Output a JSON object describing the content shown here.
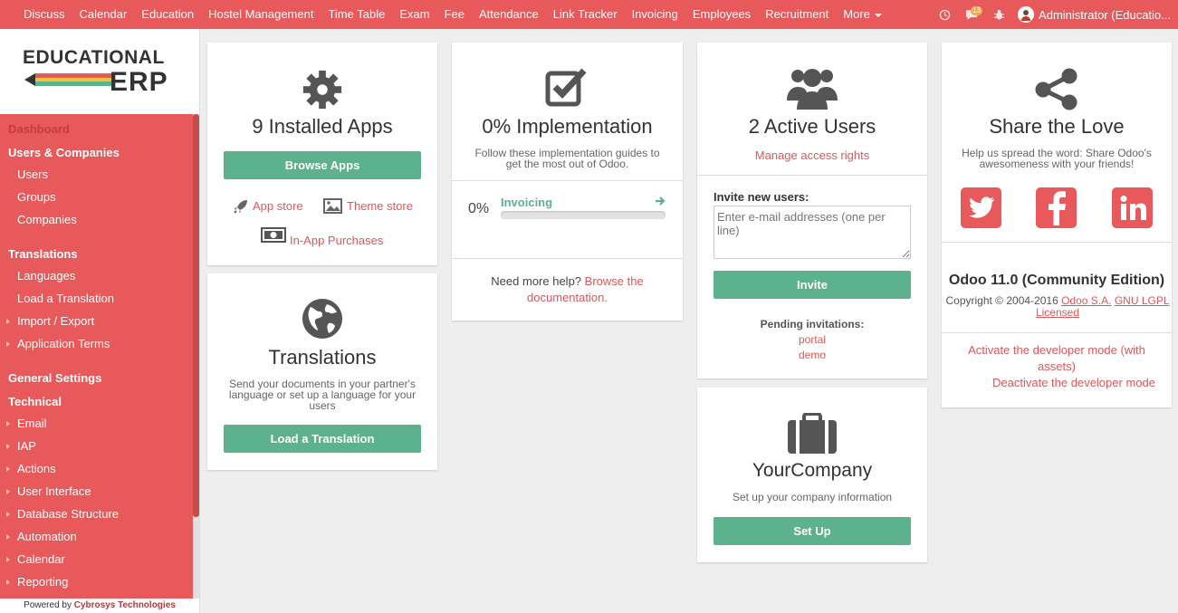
{
  "topbar": {
    "menus": [
      "Discuss",
      "Calendar",
      "Education",
      "Hostel Management",
      "Time Table",
      "Exam",
      "Fee",
      "Attendance",
      "Link Tracker",
      "Invoicing",
      "Employees",
      "Recruitment"
    ],
    "more_label": "More",
    "chat_count": "13",
    "user_name": "Administrator (Educatio..."
  },
  "sidebar": {
    "logo_line1": "EDUCATIONAL",
    "logo_line2": "ERP",
    "active": "Dashboard",
    "users_companies": "Users & Companies",
    "users": "Users",
    "groups": "Groups",
    "companies": "Companies",
    "translations": "Translations",
    "languages": "Languages",
    "load_translation": "Load a Translation",
    "import_export": "Import / Export",
    "application_terms": "Application Terms",
    "general_settings": "General Settings",
    "technical": "Technical",
    "email": "Email",
    "iap": "IAP",
    "actions": "Actions",
    "user_interface": "User Interface",
    "database_structure": "Database Structure",
    "automation": "Automation",
    "calendar": "Calendar",
    "reporting": "Reporting",
    "powered_by": "Powered by",
    "powered_company": "Cybrosys Technologies"
  },
  "apps_card": {
    "title": "9 Installed Apps",
    "button": "Browse Apps",
    "app_store": "App store",
    "theme_store": "Theme store",
    "in_app": "In-App Purchases"
  },
  "translations_card": {
    "title": "Translations",
    "description": "Send your documents in your partner's language or set up a language for your users",
    "button": "Load a Translation"
  },
  "implementation_card": {
    "title": "0% Implementation",
    "description": "Follow these implementation guides to get the most out of Odoo.",
    "percent": "0%",
    "guide": "Invoicing",
    "progress": 0,
    "help_text": "Need more help?",
    "help_link": "Browse the documentation."
  },
  "users_card": {
    "title": "2 Active Users",
    "manage": "Manage access rights",
    "invite_label": "Invite new users:",
    "invite_placeholder": "Enter e-mail addresses (one per line)",
    "invite_button": "Invite",
    "pending_label": "Pending invitations:",
    "pending": [
      "portal",
      "demo"
    ]
  },
  "company_card": {
    "title": "YourCompany",
    "description": "Set up your company information",
    "button": "Set Up"
  },
  "share_card": {
    "title": "Share the Love",
    "description": "Help us spread the word: Share Odoo's awesomeness with your friends!",
    "version": "Odoo 11.0 (Community Edition)",
    "copyright": "Copyright © 2004-2016",
    "odoo_sa": "Odoo S.A.",
    "license": "GNU LGPL Licensed",
    "dev_mode": "Activate the developer mode (with assets)",
    "deactivate": "Deactivate the developer mode"
  },
  "colors": {
    "brand": "#e8595b",
    "button": "#5cb28d",
    "link": "#e0575a"
  }
}
